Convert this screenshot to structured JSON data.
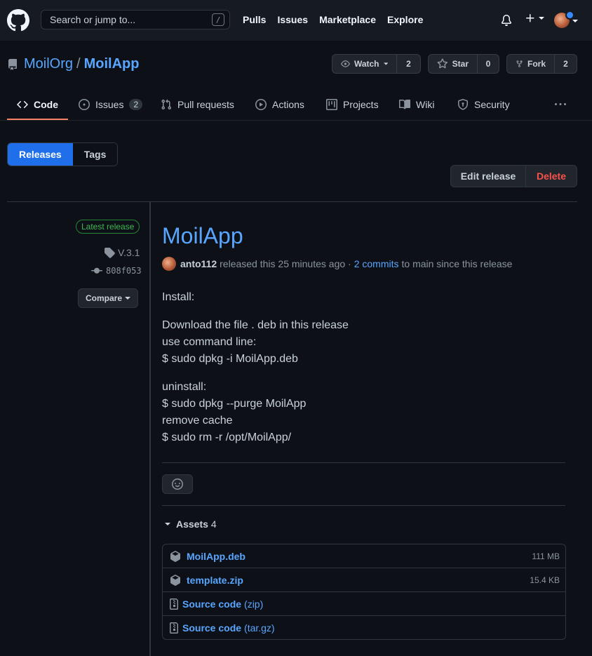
{
  "header": {
    "search_placeholder": "Search or jump to...",
    "search_shortcut": "/",
    "nav": [
      "Pulls",
      "Issues",
      "Marketplace",
      "Explore"
    ]
  },
  "repo": {
    "owner": "MoilOrg",
    "separator": "/",
    "name": "MoilApp",
    "watch_label": "Watch",
    "watch_count": "2",
    "star_label": "Star",
    "star_count": "0",
    "fork_label": "Fork",
    "fork_count": "2"
  },
  "tabs": {
    "code": "Code",
    "issues": "Issues",
    "issues_count": "2",
    "pulls": "Pull requests",
    "actions": "Actions",
    "projects": "Projects",
    "wiki": "Wiki",
    "security": "Security"
  },
  "toggle": {
    "releases": "Releases",
    "tags": "Tags"
  },
  "release_actions": {
    "edit": "Edit release",
    "delete": "Delete"
  },
  "meta": {
    "latest_badge": "Latest release",
    "tag": "V.3.1",
    "commit": "808f053",
    "compare": "Compare"
  },
  "release": {
    "title": "MoilApp",
    "author": "anto112",
    "released_text": "released this 25 minutes ago ·",
    "commits_link": "2 commits",
    "commits_suffix": "to main since this release",
    "body": {
      "p1": "Install:",
      "p2_l1": "Download the file . deb in this release",
      "p2_l2": "use command line:",
      "p2_l3": "$ sudo dpkg -i MoilApp.deb",
      "p3_l1": "uninstall:",
      "p3_l2": "$ sudo dpkg --purge MoilApp",
      "p3_l3": "remove cache",
      "p3_l4": "$ sudo rm -r /opt/MoilApp/"
    }
  },
  "assets": {
    "label": "Assets",
    "count": "4",
    "items": [
      {
        "name": "MoilApp.deb",
        "ext": "",
        "size": "111 MB"
      },
      {
        "name": "template.zip",
        "ext": "",
        "size": "15.4 KB"
      },
      {
        "name": "Source code",
        "ext": "(zip)",
        "size": ""
      },
      {
        "name": "Source code",
        "ext": "(tar.gz)",
        "size": ""
      }
    ]
  },
  "colors": {
    "bg": "#0d1117",
    "header_bg": "#161b22",
    "accent": "#58a6ff",
    "primary_button": "#1f6feb",
    "danger": "#f85149",
    "success": "#3fb950",
    "tab_underline": "#f78166"
  }
}
